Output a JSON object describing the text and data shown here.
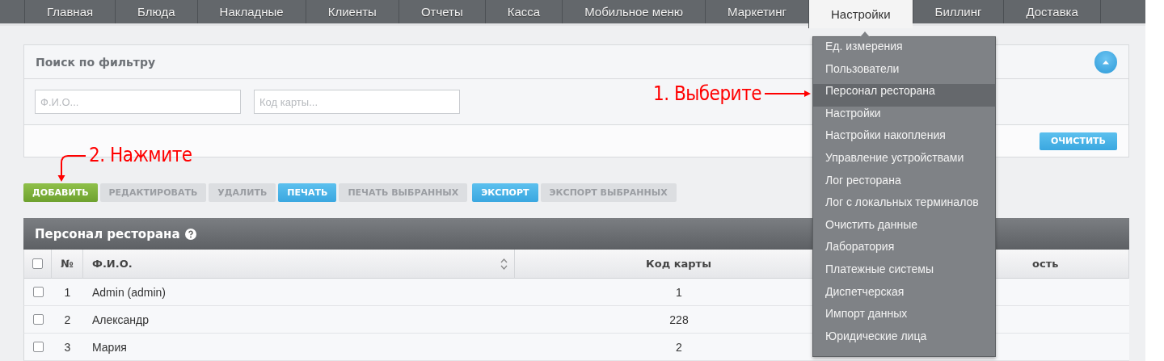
{
  "nav": {
    "tabs": [
      {
        "label": "Главная",
        "selected": false
      },
      {
        "label": "Блюда",
        "selected": false
      },
      {
        "label": "Накладные",
        "selected": false
      },
      {
        "label": "Клиенты",
        "selected": false
      },
      {
        "label": "Отчеты",
        "selected": false
      },
      {
        "label": "Касса",
        "selected": false
      },
      {
        "label": "Мобильное меню",
        "selected": false
      },
      {
        "label": "Маркетинг",
        "selected": false
      },
      {
        "label": "Настройки",
        "selected": true
      },
      {
        "label": "Биллинг",
        "selected": false
      },
      {
        "label": "Доставка",
        "selected": false
      }
    ]
  },
  "filter": {
    "title": "Поиск по фильтру",
    "fields": [
      {
        "placeholder": "Ф.И.О..."
      },
      {
        "placeholder": "Код карты..."
      }
    ],
    "clear_button": "ОЧИСТИТЬ"
  },
  "toolbar": {
    "buttons": [
      {
        "label": "ДОБАВИТЬ",
        "kind": "add"
      },
      {
        "label": "РЕДАКТИРОВАТЬ",
        "kind": "disabled"
      },
      {
        "label": "УДАЛИТЬ",
        "kind": "disabled"
      },
      {
        "label": "ПЕЧАТЬ",
        "kind": "primary"
      },
      {
        "label": "ПЕЧАТЬ ВЫБРАННЫХ",
        "kind": "disabled"
      },
      {
        "label": "ЭКСПОРТ",
        "kind": "primary"
      },
      {
        "label": "ЭКСПОРТ ВЫБРАННЫХ",
        "kind": "disabled"
      }
    ]
  },
  "table": {
    "title": "Персонал ресторана",
    "header_checked": false,
    "columns": [
      "№",
      "Ф.И.О.",
      "Код карты",
      "ость"
    ],
    "rows": [
      {
        "checked": false,
        "number": "1",
        "name": "Admin (admin)",
        "card": "1"
      },
      {
        "checked": false,
        "number": "2",
        "name": "Александр",
        "card": "228"
      },
      {
        "checked": false,
        "number": "3",
        "name": "Мария",
        "card": "2"
      }
    ]
  },
  "dropdown": {
    "items": [
      {
        "label": "Ед. измерения",
        "selected": false
      },
      {
        "label": "Пользователи",
        "selected": false
      },
      {
        "label": "Персонал ресторана",
        "selected": true
      },
      {
        "label": "Настройки",
        "selected": false
      },
      {
        "label": "Настройки накопления",
        "selected": false
      },
      {
        "label": "Управление устройствами",
        "selected": false
      },
      {
        "label": "Лог ресторана",
        "selected": false
      },
      {
        "label": "Лог с локальных терминалов",
        "selected": false
      },
      {
        "label": "Очистить данные",
        "selected": false
      },
      {
        "label": "Лаборатория",
        "selected": false
      },
      {
        "label": "Платежные системы",
        "selected": false
      },
      {
        "label": "Диспетчерская",
        "selected": false
      },
      {
        "label": "Импорт данных",
        "selected": false
      },
      {
        "label": "Юридические лица",
        "selected": false
      }
    ]
  },
  "annotations": [
    {
      "text": "1. Выберите"
    },
    {
      "text": "2. Нажмите"
    }
  ]
}
